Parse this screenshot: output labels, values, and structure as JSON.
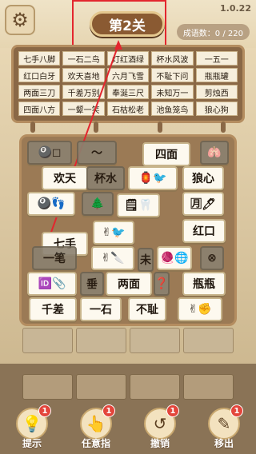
{
  "header": {
    "version": "1.0.22",
    "level_title": "第2关",
    "idiom_count": "成语数：0 / 220"
  },
  "board": {
    "idioms": [
      "七手八脚",
      "一石二鸟",
      "灯红酒绿",
      "杯水风波",
      "一五一",
      "红口白牙",
      "欢天喜地",
      "六月飞雪",
      "不耻下问",
      "瓶瓶罐",
      "两面三刀",
      "千差万别",
      "奉涎三尺",
      "未知万一",
      "剪烛西",
      "四面八方",
      "一颦一笑",
      "石枯松老",
      "池鱼笼鸟",
      "狼心狗"
    ]
  },
  "tiles": [
    {
      "text": "🎱◻",
      "dim": true
    },
    {
      "text": "〜",
      "dim": true
    },
    {
      "text": "四面",
      "dim": false
    },
    {
      "text": "🫁",
      "dim": true
    },
    {
      "text": "欢天",
      "dim": false
    },
    {
      "text": "杯水",
      "dim": true
    },
    {
      "text": "🏮🐦",
      "dim": false
    },
    {
      "text": "狼心",
      "dim": false
    },
    {
      "text": "🎱👣",
      "dim": false
    },
    {
      "text": "🌲",
      "dim": true
    },
    {
      "text": "🗒🦷",
      "dim": false
    },
    {
      "text": "🈷🖊",
      "dim": false
    },
    {
      "text": "七手",
      "dim": false
    },
    {
      "text": "✌🐦",
      "dim": false
    },
    {
      "text": "红口",
      "dim": false
    },
    {
      "text": "一笔",
      "dim": true
    },
    {
      "text": "✌🔪",
      "dim": false
    },
    {
      "text": "未",
      "dim": true
    },
    {
      "text": "🧶🌐",
      "dim": false
    },
    {
      "text": "⊗",
      "dim": true
    },
    {
      "text": "🆔📎",
      "dim": false
    },
    {
      "text": "垂",
      "dim": true
    },
    {
      "text": "两面",
      "dim": false
    },
    {
      "text": "❓",
      "dim": true
    },
    {
      "text": "瓶瓶",
      "dim": false
    },
    {
      "text": "千差",
      "dim": false
    },
    {
      "text": "一石",
      "dim": false
    },
    {
      "text": "不耻",
      "dim": false
    },
    {
      "text": "✌✊",
      "dim": false
    }
  ],
  "tools": [
    {
      "label": "提示",
      "icon": "💡",
      "badge": "1"
    },
    {
      "label": "任意指",
      "icon": "👆",
      "badge": "1"
    },
    {
      "label": "撤销",
      "icon": "↺",
      "badge": "1"
    },
    {
      "label": "移出",
      "icon": "✎",
      "badge": "1"
    }
  ]
}
